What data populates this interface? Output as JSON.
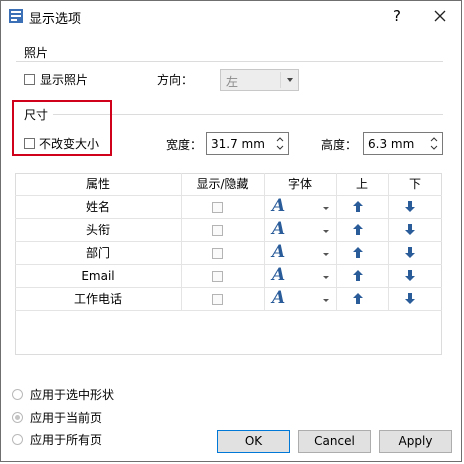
{
  "window": {
    "title": "显示选项",
    "help": "?"
  },
  "photo": {
    "section": "照片",
    "show_photo": "显示照片",
    "direction_label": "方向：",
    "direction_value": "左"
  },
  "size": {
    "section": "尺寸",
    "keep_size": "不改变大小",
    "width_label": "宽度：",
    "width_value": "31.7 mm",
    "height_label": "高度：",
    "height_value": "6.3 mm"
  },
  "table": {
    "headers": [
      "属性",
      "显示/隐藏",
      "字体",
      "上",
      "下"
    ],
    "font_glyph": "A",
    "rows": [
      {
        "attribute": "姓名"
      },
      {
        "attribute": "头衔"
      },
      {
        "attribute": "部门"
      },
      {
        "attribute": "Email"
      },
      {
        "attribute": "工作电话"
      }
    ]
  },
  "apply_scope": {
    "options": [
      "应用于选中形状",
      "应用于当前页",
      "应用于所有页"
    ],
    "selected": 1
  },
  "buttons": {
    "ok": "OK",
    "cancel": "Cancel",
    "apply": "Apply"
  },
  "colors": {
    "highlight": "#d0021b",
    "font_icon": "#2a5c9a",
    "arrow": "#2a5c9a",
    "default_button_border": "#0078d7"
  },
  "icons": {
    "app": "display-options-icon",
    "close": "close-icon",
    "up": "arrow-up-icon",
    "down": "arrow-down-icon",
    "font": "font-icon"
  }
}
